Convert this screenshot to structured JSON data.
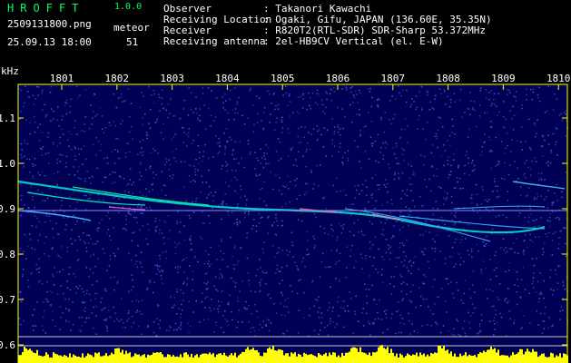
{
  "app": {
    "title": "HROFFT",
    "version": "1.0.0"
  },
  "file": {
    "name": "2509131800.png",
    "datetime": "25.09.13 18:00"
  },
  "meteor": {
    "label": "meteor",
    "count": "51"
  },
  "meta": [
    {
      "label": "Observer",
      "value": ": Takanori Kawachi"
    },
    {
      "label": "Receiving Location",
      "value": ": Ogaki, Gifu, JAPAN (136.60E, 35.35N)"
    },
    {
      "label": "Receiver",
      "value": ": R820T2(RTL-SDR) SDR-Sharp 53.372MHz"
    },
    {
      "label": "Receiving antenna",
      "value": ": 2el-HB9CV Vertical (el. E-W)"
    }
  ],
  "chart_data": {
    "type": "heatmap",
    "ylabel": "kHz",
    "x_ticks": [
      "1801",
      "1802",
      "1803",
      "1804",
      "1805",
      "1806",
      "1807",
      "1808",
      "1809",
      "1810"
    ],
    "y_ticks": [
      "1.1",
      "1.0",
      "0.9",
      "0.8",
      "0.7",
      "0.6"
    ],
    "colors": {
      "axis": "#ffff00",
      "background": "#000060",
      "trace": "#00ffcc",
      "level": "#ffff00"
    }
  }
}
